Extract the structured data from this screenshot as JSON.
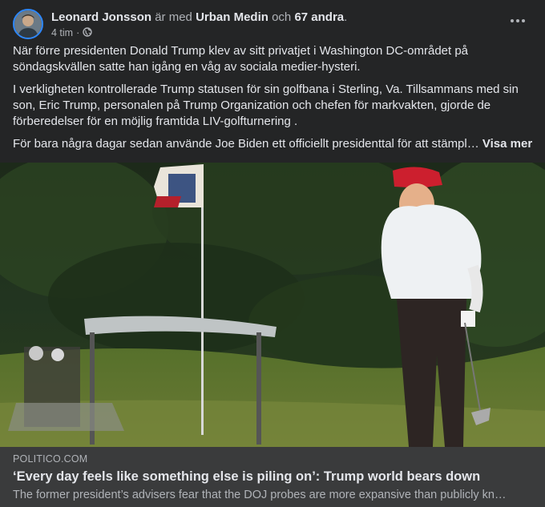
{
  "post": {
    "author": "Leonard Jonsson",
    "with_text": "är med",
    "tagged": "Urban Medin",
    "and_text": "och",
    "others": "67 andra",
    "period": ".",
    "time": "4 tim",
    "separator": "·",
    "audience_icon": "globe-icon",
    "more_icon": "more-options-icon"
  },
  "body": {
    "p1": "När förre presidenten Donald Trump klev av sitt privatjet i Washington DC-området på söndagskvällen satte han igång en våg av sociala medier-hysteri.",
    "p2": "I verkligheten kontrollerade Trump statusen för sin golfbana i Sterling, Va. Tillsammans med sin son, Eric Trump, personalen på Trump Organization och chefen för markvakten, gjorde de förberedelser för en möjlig framtida LIV-golfturnering .",
    "p3": "För bara några dagar sedan använde Joe Biden ett officiellt presidenttal för att stämpl…",
    "see_more": "Visa mer"
  },
  "link": {
    "domain": "POLITICO.COM",
    "headline": "‘Every day feels like something else is piling on’: Trump world bears down",
    "description": "The former president’s advisers fear that the DOJ probes are more expansive than publicly kn…"
  },
  "colors": {
    "background": "#242526",
    "card": "#3a3b3c",
    "text": "#e4e6eb",
    "secondary": "#b0b3b8",
    "avatar_ring": "#2d88ff"
  }
}
